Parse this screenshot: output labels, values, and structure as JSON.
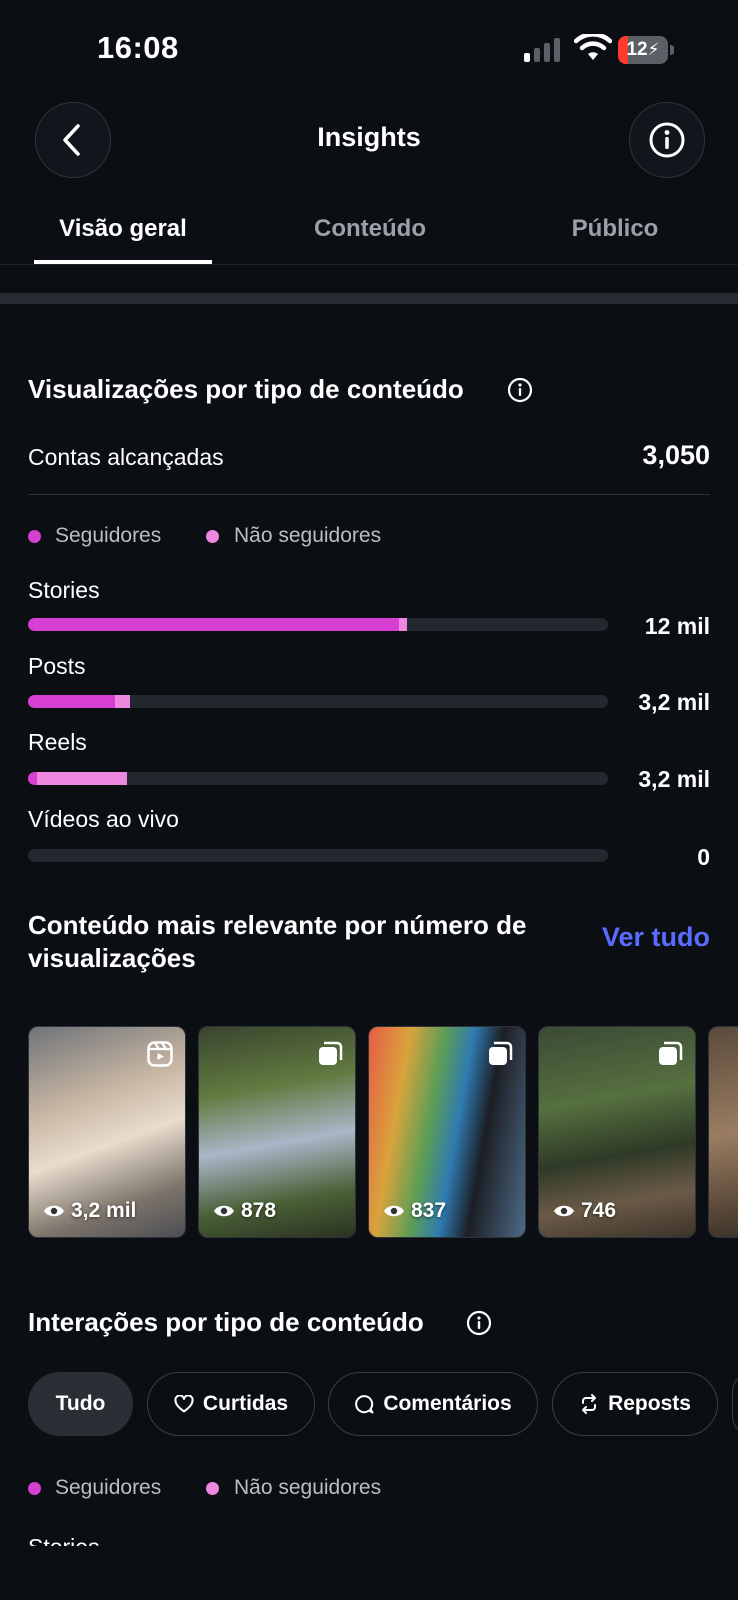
{
  "status_bar": {
    "time": "16:08",
    "battery": "12"
  },
  "header": {
    "title": "Insights"
  },
  "tabs": [
    {
      "label": "Visão geral",
      "active": true
    },
    {
      "label": "Conteúdo",
      "active": false
    },
    {
      "label": "Público",
      "active": false
    }
  ],
  "views_section": {
    "title": "Visualizações por tipo de conteúdo",
    "reach_label": "Contas alcançadas",
    "reach_value": "3,050",
    "legend": {
      "followers": "Seguidores",
      "non_followers": "Não seguidores"
    },
    "rows": [
      {
        "label": "Stories",
        "value": "12 mil",
        "followers_pct": 64,
        "non_followers_pct": 1.3
      },
      {
        "label": "Posts",
        "value": "3,2 mil",
        "followers_pct": 15,
        "non_followers_pct": 2.6
      },
      {
        "label": "Reels",
        "value": "3,2 mil",
        "followers_pct": 1.5,
        "non_followers_pct": 15.5
      },
      {
        "label": "Vídeos ao vivo",
        "value": "0",
        "followers_pct": 0,
        "non_followers_pct": 0
      }
    ]
  },
  "top_content": {
    "title": "Conteúdo mais relevante por número de visualizações",
    "see_all": "Ver tudo",
    "items": [
      {
        "type": "reel-icon",
        "views": "3,2 mil"
      },
      {
        "type": "carousel-icon",
        "views": "878"
      },
      {
        "type": "carousel-icon",
        "views": "837"
      },
      {
        "type": "carousel-icon",
        "views": "746"
      },
      {
        "type": "",
        "views": ""
      }
    ]
  },
  "interactions_section": {
    "title": "Interações por tipo de conteúdo",
    "chips": [
      {
        "label": "Tudo",
        "icon": ""
      },
      {
        "label": "Curtidas",
        "icon": "heart-icon"
      },
      {
        "label": "Comentários",
        "icon": "comment-icon"
      },
      {
        "label": "Reposts",
        "icon": "repost-icon"
      }
    ],
    "legend": {
      "followers": "Seguidores",
      "non_followers": "Não seguidores"
    },
    "first_row_label": "Stories"
  },
  "colors": {
    "followers": "#d63fd1",
    "non_followers": "#ee87e0",
    "link": "#5a6cff",
    "background": "#0b0f14"
  }
}
